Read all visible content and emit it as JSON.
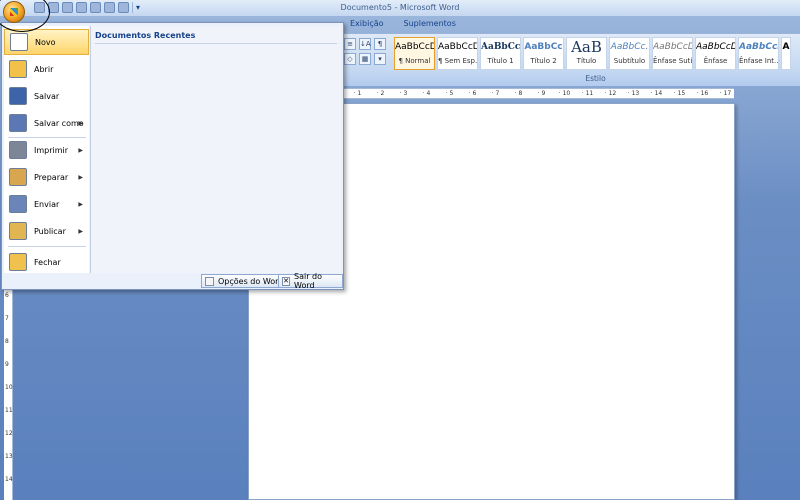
{
  "window": {
    "title": "Documento5 - Microsoft Word"
  },
  "quick_access": {
    "icons": [
      "undo-icon",
      "redo-icon",
      "print-preview-icon",
      "new-document-icon",
      "quick-print-icon",
      "save-icon",
      "open-icon",
      "customize-qat-icon"
    ],
    "customize_glyph": "▾"
  },
  "ribbon": {
    "tabs": [
      {
        "label": "Exibição"
      },
      {
        "label": "Suplementos"
      }
    ],
    "paragraph_tools": [
      "≡",
      "↓A",
      "¶",
      "◇",
      "▦",
      "▾"
    ],
    "launcher_glyph": "↘",
    "styles": [
      {
        "sample": "AaBbCcDc",
        "name": "¶ Normal",
        "selected": true
      },
      {
        "sample": "AaBbCcDc",
        "name": "¶ Sem Esp..."
      },
      {
        "sample": "AaBbCc",
        "name": "Título 1"
      },
      {
        "sample": "AaBbCc",
        "name": "Título 2"
      },
      {
        "sample": "AaB",
        "name": "Título"
      },
      {
        "sample": "AaBbCc.",
        "name": "Subtítulo"
      },
      {
        "sample": "AaBbCcDc",
        "name": "Ênfase Sutil"
      },
      {
        "sample": "AaBbCcDc",
        "name": "Ênfase"
      },
      {
        "sample": "AaBbCcDc",
        "name": "Ênfase Int..."
      },
      {
        "sample": "A",
        "name": ""
      }
    ],
    "group_label": "Estilo"
  },
  "ruler": {
    "horizontal_labels": [
      "1",
      "2",
      "3",
      "4",
      "5",
      "6",
      "7",
      "8",
      "9",
      "10",
      "11",
      "12",
      "13",
      "14",
      "15",
      "16",
      "17"
    ],
    "vertical_labels": [
      "6",
      "7",
      "8",
      "9",
      "10",
      "11",
      "12",
      "13",
      "14"
    ]
  },
  "office_menu": {
    "items": [
      {
        "label": "Novo",
        "icon": "new-document-icon",
        "arrow": false,
        "active": true,
        "color": "#ffffff"
      },
      {
        "label": "Abrir",
        "icon": "folder-open-icon",
        "arrow": false,
        "color": "#f2c14a"
      },
      {
        "label": "Salvar",
        "icon": "floppy-disk-icon",
        "arrow": false,
        "color": "#3d63a8"
      },
      {
        "label": "Salvar como",
        "icon": "save-as-icon",
        "arrow": true,
        "color": "#5b78b5"
      },
      {
        "label": "Imprimir",
        "icon": "printer-icon",
        "arrow": true,
        "color": "#7c8696"
      },
      {
        "label": "Preparar",
        "icon": "prepare-icon",
        "arrow": true,
        "color": "#d7a64f"
      },
      {
        "label": "Enviar",
        "icon": "send-mail-icon",
        "arrow": true,
        "color": "#6a86b8"
      },
      {
        "label": "Publicar",
        "icon": "publish-icon",
        "arrow": true,
        "color": "#e0b552"
      },
      {
        "label": "Fechar",
        "icon": "close-folder-icon",
        "arrow": false,
        "color": "#f1c14d"
      }
    ],
    "arrow_glyph": "▶",
    "recent_title": "Documentos Recentes",
    "options_label": "Opções do Word",
    "exit_label": "Sair do Word",
    "exit_glyph": "✕"
  }
}
